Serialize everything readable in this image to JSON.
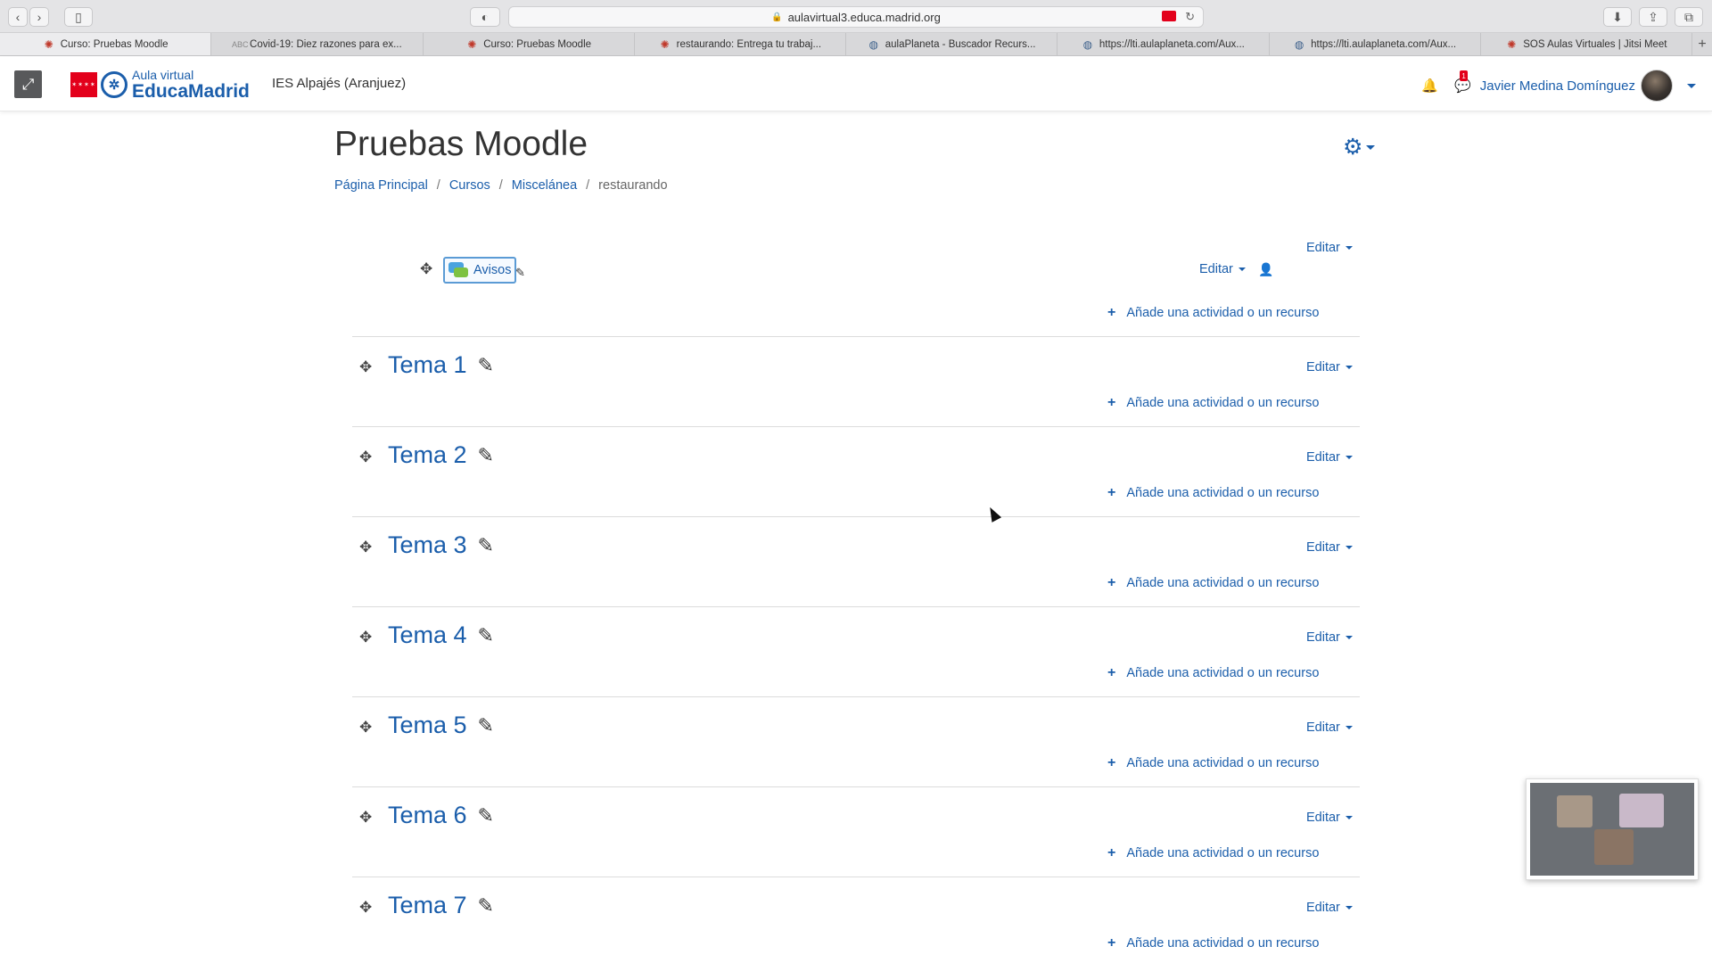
{
  "browser": {
    "url": "aulavirtual3.educa.madrid.org",
    "tabs": [
      {
        "label": "Curso: Pruebas Moodle",
        "icon": "moodle-icon",
        "active": true
      },
      {
        "label": "Covid-19: Diez razones para ex...",
        "icon": "abc-icon",
        "active": false
      },
      {
        "label": "Curso: Pruebas Moodle",
        "icon": "moodle-icon",
        "active": false
      },
      {
        "label": "restaurando: Entrega tu trabaj...",
        "icon": "moodle-icon",
        "active": false
      },
      {
        "label": "aulaPlaneta - Buscador Recurs...",
        "icon": "globe-icon",
        "active": false
      },
      {
        "label": "https://lti.aulaplaneta.com/Aux...",
        "icon": "globe-icon",
        "active": false
      },
      {
        "label": "https://lti.aulaplaneta.com/Aux...",
        "icon": "globe-icon",
        "active": false
      },
      {
        "label": "SOS Aulas Virtuales | Jitsi Meet",
        "icon": "moodle-icon",
        "active": false
      }
    ]
  },
  "navbar": {
    "logo_top": "Aula virtual",
    "logo_bottom": "EducaMadrid",
    "site_name": "IES Alpajés (Aranjuez)",
    "message_count": "1",
    "user_name": "Javier Medina Domínguez"
  },
  "page": {
    "title": "Pruebas Moodle",
    "breadcrumb": [
      "Página Principal",
      "Cursos",
      "Miscelánea",
      "restaurando"
    ]
  },
  "course": {
    "edit_label": "Editar",
    "add_activity_label": "Añade una actividad o un recurso",
    "general_section": {
      "activity_name": "Avisos"
    },
    "sections": [
      {
        "title": "Tema 1"
      },
      {
        "title": "Tema 2"
      },
      {
        "title": "Tema 3"
      },
      {
        "title": "Tema 4"
      },
      {
        "title": "Tema 5"
      },
      {
        "title": "Tema 6"
      },
      {
        "title": "Tema 7"
      }
    ]
  }
}
